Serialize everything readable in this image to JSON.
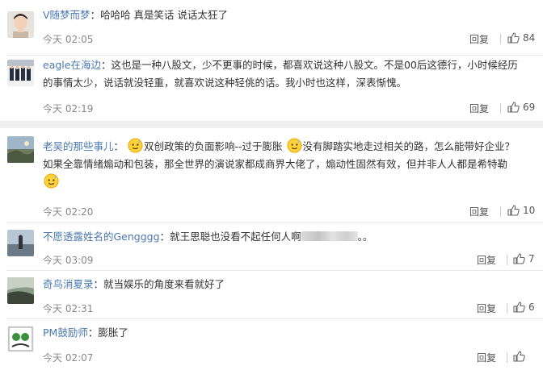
{
  "comments": [
    {
      "user": "V随梦而梦",
      "separator": "：",
      "text": "哈哈哈 真是笑话 说话太狂了",
      "time": "今天 02:05",
      "reply": "回复",
      "likes": "84",
      "avatar": "avatar-photo"
    },
    {
      "user": "eagle在海边",
      "separator": "：",
      "text_line1": "这也是一种八股文，少不更事的时候，都喜欢说这种八股文。不是00后这德行，小时候经历",
      "text_line2": "的事情太少，说话就没轻重，就喜欢说这种轻佻的话。我小时也这样，深表惭愧。",
      "time": "今天 02:19",
      "reply": "回复",
      "likes": "69",
      "avatar": "avatar-photo"
    },
    {
      "user": "老吴的那些事儿",
      "separator": "：",
      "text_a": "双创政策的负面影响--过于膨胀",
      "text_b": "没有脚踏实地走过相关的路，怎么能带好企业？",
      "text_line2": "如果全靠情绪煽动和包装，那全世界的演说家都成商界大佬了，煽动性固然有效，但并非人人都是希特勒",
      "time": "今天 02:20",
      "reply": "回复",
      "likes": "10",
      "avatar": "avatar-photo",
      "emoji": "sweat-smile-emoji"
    },
    {
      "user": "不愿透露姓名的Gengggg",
      "separator": "：",
      "text": "就王思聪也没看不起任何人啊",
      "text_tail": "。。",
      "time": "今天 03:09",
      "reply": "回复",
      "likes": "7",
      "avatar": "avatar-photo"
    },
    {
      "user": "奇鸟消夏录",
      "separator": "：",
      "text": "就当娱乐的角度来看就好了",
      "time": "今天 02:31",
      "reply": "回复",
      "likes": "6",
      "avatar": "avatar-photo"
    },
    {
      "user": "PM鼓励师",
      "separator": "：",
      "text": "膨胀了",
      "time": "今天 02:07",
      "reply": "回复",
      "likes": "",
      "avatar": "avatar-photo"
    }
  ],
  "icons": {
    "like": "thumbs-up-icon"
  }
}
